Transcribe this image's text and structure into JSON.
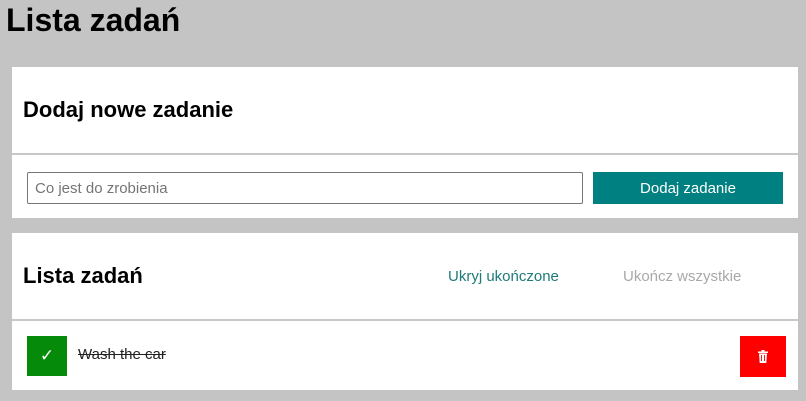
{
  "app": {
    "title": "Lista zadań"
  },
  "add_section": {
    "heading": "Dodaj nowe zadanie",
    "input_value": "",
    "input_placeholder": "Co jest do zrobienia",
    "add_button_label": "Dodaj zadanie"
  },
  "list_section": {
    "heading": "Lista zadań",
    "hide_completed_label": "Ukryj ukończone",
    "complete_all_label": "Ukończ wszystkie",
    "tasks": [
      {
        "text": "Wash the car",
        "completed": true,
        "check_glyph": "✓",
        "check_icon": "checkmark-icon",
        "delete_icon": "trash-icon"
      }
    ]
  },
  "colors": {
    "background": "#c4c4c4",
    "accent": "#008080",
    "link": "#207a7a",
    "link_disabled": "#a8a8a8",
    "done": "#068a0a",
    "danger": "#ff0000"
  }
}
